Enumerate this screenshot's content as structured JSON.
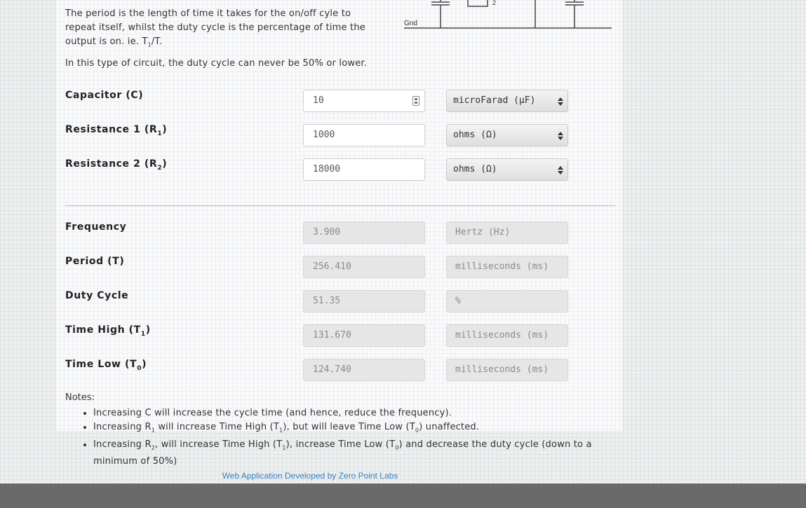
{
  "intro": {
    "period_text": "The period is the length of time it takes for the on/off cyle to repeat itself, whilst the duty cycle is the percentage of time the output is on. ie. T",
    "period_sub": "1",
    "period_end": "/T.",
    "duty_text": "In this type of circuit, the duty cycle can never be 50% or lower."
  },
  "schematic": {
    "gnd_label": "Gnd",
    "r_label": "2"
  },
  "inputs": {
    "capacitor": {
      "label": "Capacitor (C)",
      "value": "10",
      "unit": "microFarad (µF)"
    },
    "r1": {
      "label": "Resistance 1 (R",
      "sub": "1",
      "close": ")",
      "value": "1000",
      "unit": "ohms (Ω)"
    },
    "r2": {
      "label": "Resistance 2 (R",
      "sub": "2",
      "close": ")",
      "value": "18000",
      "unit": "ohms (Ω)"
    }
  },
  "outputs": {
    "frequency": {
      "label": "Frequency",
      "value": "3.900",
      "unit": "Hertz (Hz)"
    },
    "period": {
      "label": "Period (T)",
      "value": "256.410",
      "unit": "milliseconds (ms)"
    },
    "duty": {
      "label": "Duty Cycle",
      "value": "51.35",
      "unit": "%"
    },
    "time_high": {
      "label": "Time High (T",
      "sub": "1",
      "close": ")",
      "value": "131.670",
      "unit": "milliseconds (ms)"
    },
    "time_low": {
      "label": "Time Low (T",
      "sub": "0",
      "close": ")",
      "value": "124.740",
      "unit": "milliseconds (ms)"
    }
  },
  "notes": {
    "title": "Notes:",
    "n1": "Increasing C will increase the cycle time (and hence, reduce the frequency).",
    "n2a": "Increasing R",
    "n2s": "1",
    "n2b": " will increase Time High (T",
    "n2s2": "1",
    "n2c": "), but will leave Time Low (T",
    "n2s3": "0",
    "n2d": ") unaffected.",
    "n3a": "Increasing R",
    "n3s": "2",
    "n3b": ", will increase Time High (T",
    "n3s2": "1",
    "n3c": "), increase Time Low (T",
    "n3s3": "0",
    "n3d": ") and decrease the duty cycle (down to a minimum of 50%)"
  },
  "footer": {
    "credit": "Web Application Developed by Zero Point Labs"
  }
}
